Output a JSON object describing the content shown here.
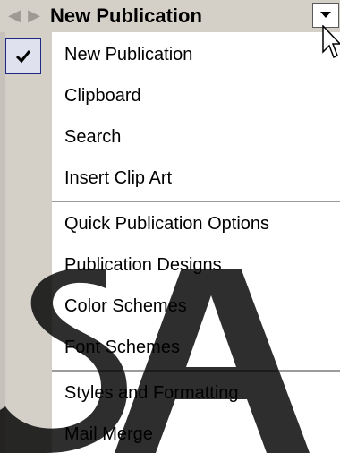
{
  "header": {
    "title": "New Publication",
    "back_icon": "back-arrow-icon",
    "forward_icon": "forward-arrow-icon",
    "dropdown_icon": "chevron-down-icon"
  },
  "menu": {
    "items": [
      {
        "label": "New Publication",
        "checked": true
      },
      {
        "label": "Clipboard",
        "checked": false
      },
      {
        "label": "Search",
        "checked": false
      },
      {
        "label": "Insert Clip Art",
        "checked": false
      },
      {
        "label": "Quick Publication Options",
        "checked": false
      },
      {
        "label": "Publication Designs",
        "checked": false
      },
      {
        "label": "Color Schemes",
        "checked": false
      },
      {
        "label": "Font Schemes",
        "checked": false
      },
      {
        "label": "Styles and Formatting",
        "checked": false
      },
      {
        "label": "Mail Merge",
        "checked": false
      }
    ]
  },
  "watermark": {
    "text": "SA"
  },
  "colors": {
    "pane_gray": "#d4d0c8",
    "check_border": "#1c2a83",
    "watermark": "#000000"
  }
}
